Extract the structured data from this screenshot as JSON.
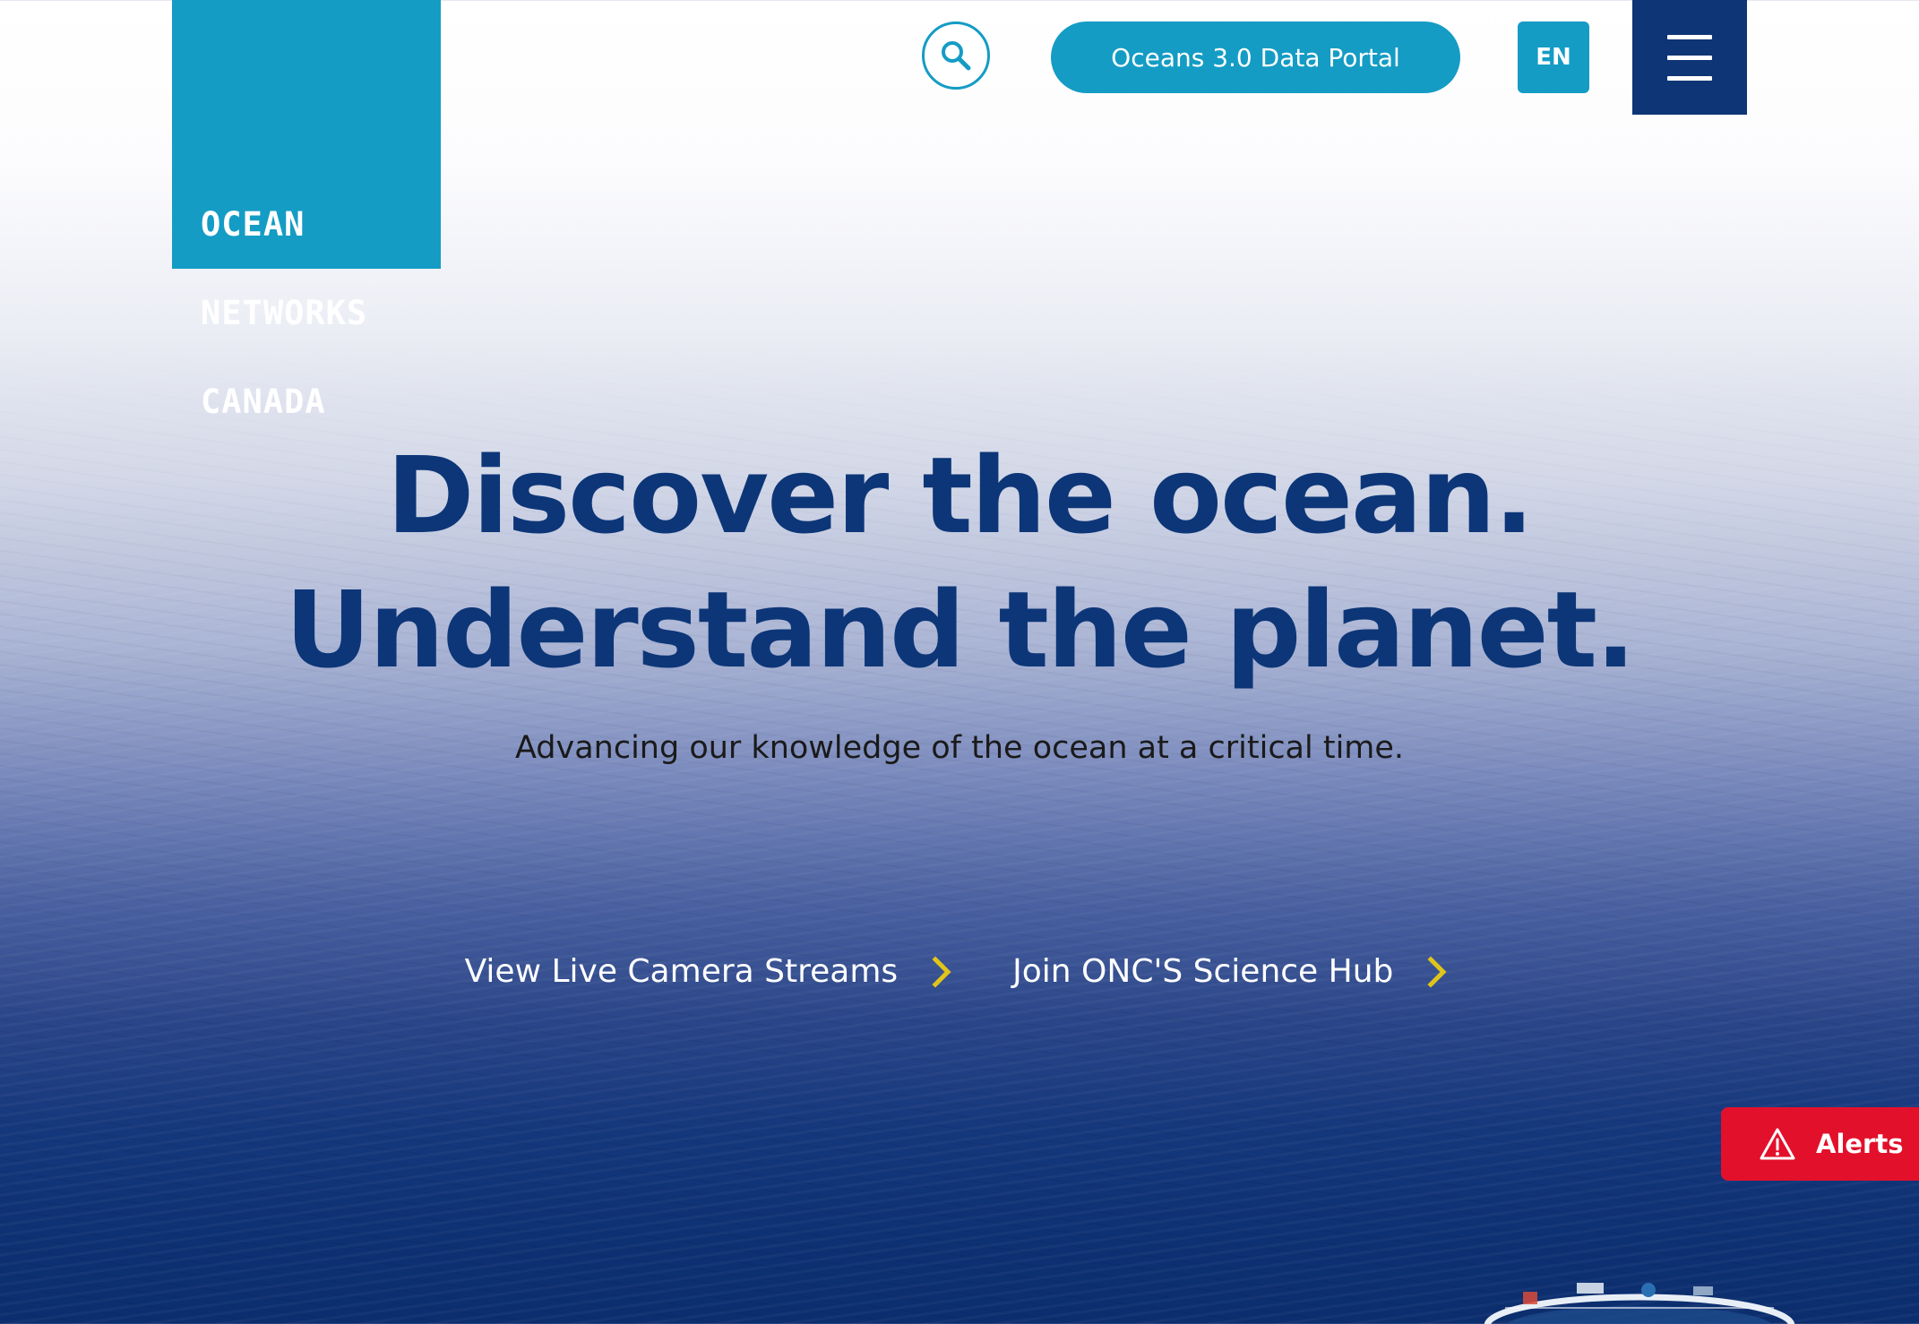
{
  "brand": {
    "logo_lines": [
      "OCEAN",
      "NETWORKS",
      "CANADA"
    ],
    "color": "#149cc5",
    "navy": "#0d3678"
  },
  "header": {
    "search_icon": "search-icon",
    "portal_label": "Oceans 3.0 Data Portal",
    "lang_label": "EN",
    "menu_icon": "hamburger-icon"
  },
  "hero": {
    "title_line1": "Discover the ocean.",
    "title_line2": "Understand the planet.",
    "subtitle": "Advancing our knowledge of the ocean at a critical time.",
    "ctas": [
      {
        "label": "View Live Camera Streams",
        "icon": "chevron-right-icon"
      },
      {
        "label": "Join ONC'S Science Hub",
        "icon": "chevron-right-icon"
      }
    ],
    "accent": "#e0c41a"
  },
  "alerts": {
    "label": "Alerts",
    "icon": "warning-icon",
    "color": "#e3102b"
  }
}
